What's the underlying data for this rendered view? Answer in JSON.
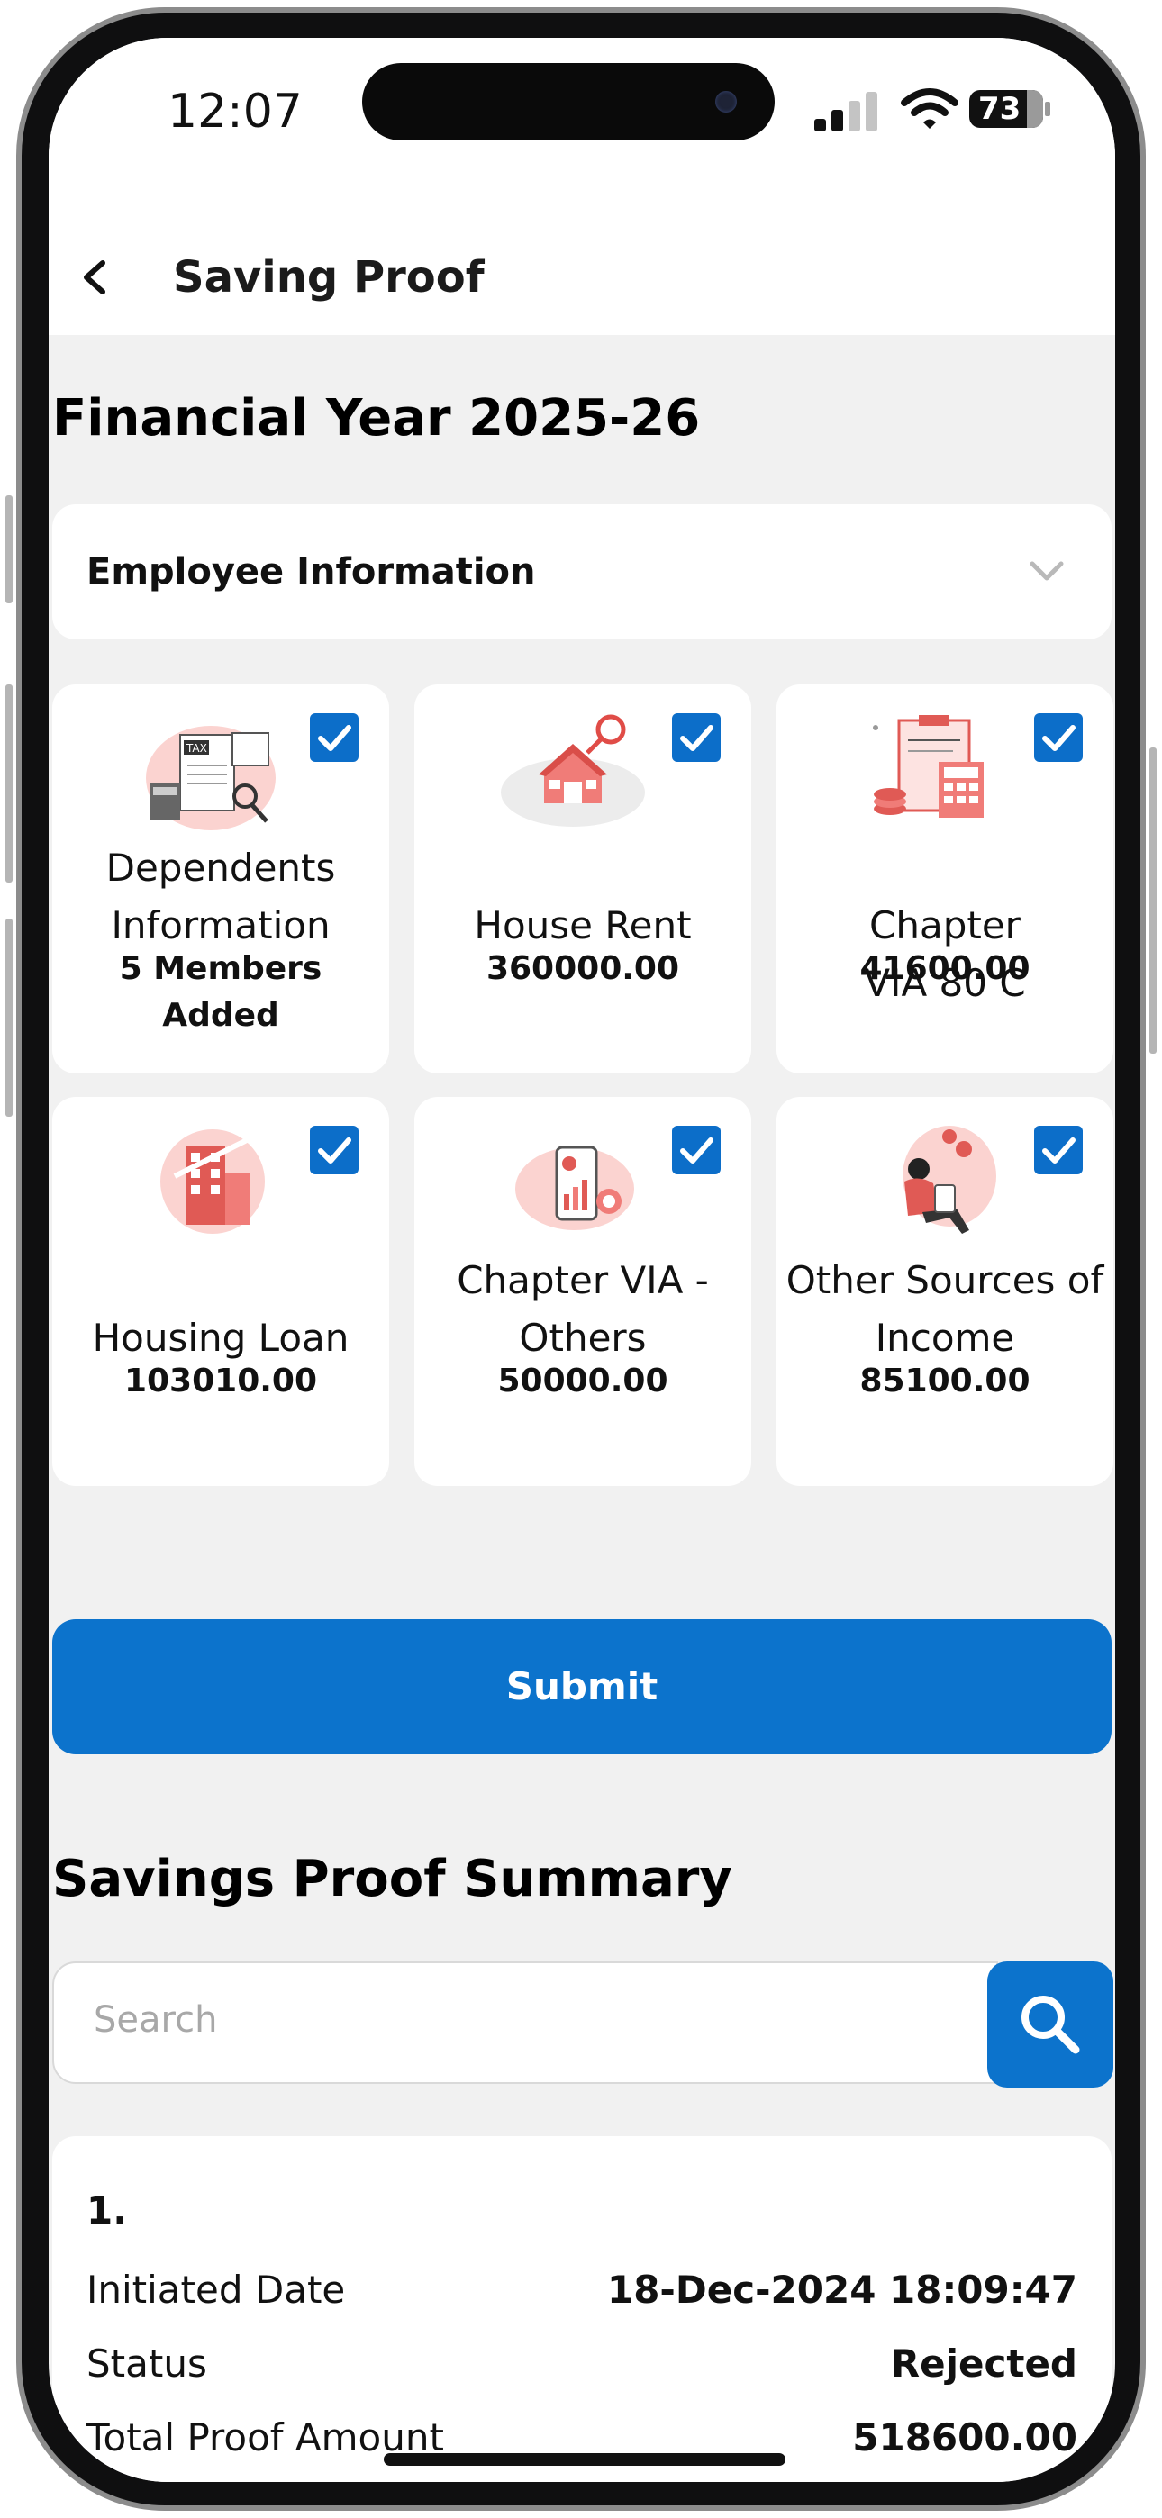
{
  "status_bar": {
    "time": "12:07",
    "battery": "73"
  },
  "header": {
    "title": "Saving Proof"
  },
  "financial_year": "Financial Year 2025-26",
  "employee_info": {
    "label": "Employee Information"
  },
  "tiles": [
    {
      "label": "Dependents Information",
      "value": "5 Members Added",
      "checked": true,
      "icon": "tax-documents-icon"
    },
    {
      "label": "House Rent",
      "value": "360000.00",
      "checked": true,
      "icon": "house-search-icon"
    },
    {
      "label": "Chapter VIA 80 C",
      "value": "41600.00",
      "checked": true,
      "icon": "tax-calculator-icon"
    },
    {
      "label": "Housing Loan",
      "value": "103010.00",
      "checked": true,
      "icon": "building-loan-icon"
    },
    {
      "label": "Chapter VIA - Others",
      "value": "50000.00",
      "checked": true,
      "icon": "phone-chart-icon"
    },
    {
      "label": "Other Sources of Income",
      "value": "85100.00",
      "checked": true,
      "icon": "person-money-icon"
    }
  ],
  "submit_label": "Submit",
  "summary": {
    "title": "Savings Proof Summary",
    "search_placeholder": "Search",
    "records": [
      {
        "number": "1.",
        "initiated_label": "Initiated Date",
        "initiated_value": "18-Dec-2024 18:09:47",
        "status_label": "Status",
        "status_value": "Rejected",
        "amount_label": "Total Proof Amount",
        "amount_value": "518600.00"
      }
    ]
  },
  "colors": {
    "primary": "#0c73cc",
    "background": "#f1f1f1",
    "card": "#ffffff",
    "accent_illustration": "#f07c78"
  }
}
